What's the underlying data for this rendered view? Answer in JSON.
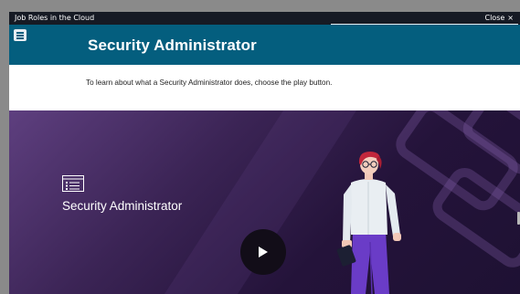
{
  "window": {
    "title": "Job Roles in the Cloud",
    "close_label": "Close",
    "close_symbol": "×"
  },
  "header": {
    "title": "Security Administrator",
    "menu_icon": "hamburger-menu-icon",
    "background": "#045e7e"
  },
  "intro": {
    "text": "To learn about what a Security Administrator does, choose the play button."
  },
  "video": {
    "title": "Security Administrator",
    "icon": "document-list-icon",
    "play_icon": "play-icon"
  }
}
